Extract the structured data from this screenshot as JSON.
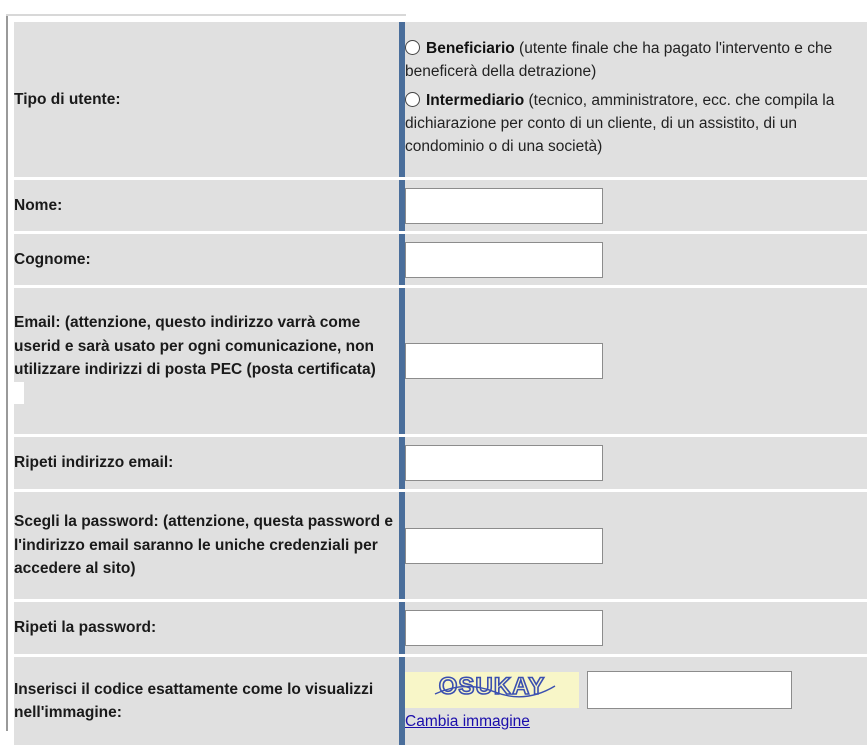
{
  "form": {
    "rows": [
      {
        "label": "Tipo di utente:"
      },
      {
        "label": "Nome:"
      },
      {
        "label": "Cognome:"
      },
      {
        "label": "Email: (attenzione, questo indirizzo varrà come userid e sarà usato per ogni comunicazione, non utilizzare indirizzi di posta PEC (posta certificata)"
      },
      {
        "label": "Ripeti indirizzo email:"
      },
      {
        "label": "Scegli la password: (attenzione, questa password e l'indirizzo email saranno le uniche credenziali per accedere al sito)"
      },
      {
        "label": "Ripeti la password:"
      },
      {
        "label": "Inserisci il codice esattamente come lo visualizzi nell'immagine:"
      }
    ],
    "user_type": {
      "beneficiario_title": "Beneficiario",
      "beneficiario_desc": " (utente finale che ha pagato l'intervento e che beneficerà della detrazione)",
      "intermediario_title": "Intermediario",
      "intermediario_desc": " (tecnico, amministratore, ecc. che compila la dichiarazione per conto di un cliente, di un assistito, di un condominio o di una società)"
    },
    "captcha": {
      "code": "OSUKAY",
      "change_link": "Cambia immagine"
    }
  },
  "colors": {
    "row_bg": "#e0e0e0",
    "separator": "#4a6e9b",
    "link": "#1a0dab",
    "captcha_bg": "#f8f6c8",
    "captcha_text": "#3a4fb0"
  }
}
